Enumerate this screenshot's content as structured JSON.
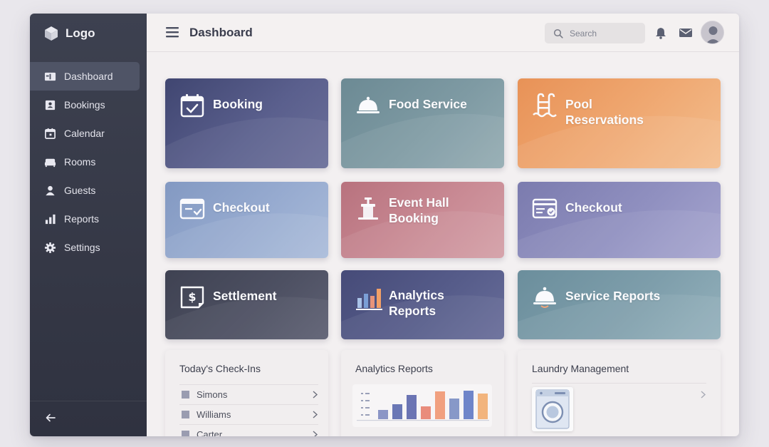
{
  "app": {
    "logo_text": "Logo",
    "page_title": "Dashboard"
  },
  "sidebar": {
    "items": [
      {
        "label": "Dashboard",
        "icon": "dashboard-icon",
        "active": true
      },
      {
        "label": "Bookings",
        "icon": "bookings-icon"
      },
      {
        "label": "Calendar",
        "icon": "calendar-icon"
      },
      {
        "label": "Rooms",
        "icon": "bed-icon"
      },
      {
        "label": "Guests",
        "icon": "person-icon"
      },
      {
        "label": "Reports",
        "icon": "bar-chart-icon"
      },
      {
        "label": "Settings",
        "icon": "gear-icon"
      }
    ]
  },
  "header": {
    "search_placeholder": "Search"
  },
  "tiles": [
    {
      "label": "Booking",
      "icon": "calendar-check-icon"
    },
    {
      "label": "Food Service",
      "icon": "cloche-icon"
    },
    {
      "label_line1": "Pool",
      "label_line2": "Reservations",
      "icon": "pool-ladder-icon"
    },
    {
      "label": "Checkout",
      "icon": "folder-check-icon"
    },
    {
      "label_line1": "Event Hall",
      "label_line2": "Booking",
      "icon": "podium-icon"
    },
    {
      "label": "Checkout",
      "icon": "card-check-icon"
    },
    {
      "label": "Settlement",
      "icon": "dollar-receipt-icon"
    },
    {
      "label_line1": "Analytics",
      "label_line2": "Reports",
      "icon": "analytics-bars-icon"
    },
    {
      "label": "Service Reports",
      "icon": "service-bell-icon"
    }
  ],
  "panels": {
    "checkins": {
      "title": "Today's Check-Ins",
      "rows": [
        "Simons",
        "Williams",
        "Carter"
      ]
    },
    "analytics": {
      "title": "Analytics Reports"
    },
    "laundry": {
      "title": "Laundry Management"
    }
  },
  "colors": {
    "sidebar": "#363a48",
    "booking": "#4f557f",
    "food_service": "#7b97a0",
    "pool": "#eda169",
    "checkout_blue": "#93a7cb",
    "event_hall": "#c5848e",
    "checkout_purple": "#8d8dbc",
    "settlement": "#4a4d5d",
    "analytics": "#555b88",
    "service_reports": "#7d9eab"
  }
}
